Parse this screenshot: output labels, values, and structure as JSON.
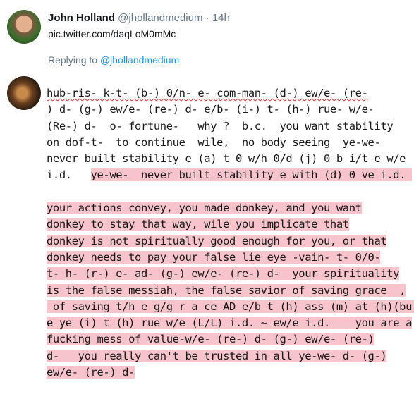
{
  "parent_tweet": {
    "display_name": "John Holland",
    "handle": "@jhollandmedium",
    "separator": "·",
    "time": "14h",
    "link": "pic.twitter.com/daqLoM0mMc"
  },
  "reply_context": {
    "prefix": "Replying to",
    "mention": "@jhollandmedium"
  },
  "reply": {
    "lines": [
      "hub-ris- k-t- (b-) 0/n- e- com-man- (d-) ew/e- (re-",
      ") d- (g-) ew/e- (re-) d- e/b- (i-) t- (h-) rue- w/e-",
      "(Re-) d-  o- fortune-   why ?  b.c.  you want stability",
      "on dof-t-  to continue  wile,  no body seeing  ye-we-",
      "never built stability e (a) t 0 w/h 0/d (j) 0 b i/t e w/e",
      "i.d.   ",
      "ye-we-  never built stability e with (d) 0 ve i.d. ",
      "your actions convey, you made donkey, and you want",
      "donkey to stay that way, wile you implicate that",
      "donkey is not spiritually good enough for you, or that",
      "donkey needs to pay your false lie eye -vain- t- 0/0-",
      "t- h- (r-) e- ad- (g-) ew/e- (re-) d-  your spirituality",
      "is the false messiah, the false savior of saving grace  ,",
      " of saving t/h e g/g r a ce AD e/b t (h) ass (m) at (h)(bu)",
      "e ye (i) t (h) rue w/e (L/L) i.d. ~ ew/e i.d.    you are a",
      "fucking mess of value-w/e- (re-) d- (g-) ew/e- (re-)",
      "d-   you really can't be trusted in all ye-we- d- (g-)",
      "ew/e- (re-) d-"
    ]
  }
}
